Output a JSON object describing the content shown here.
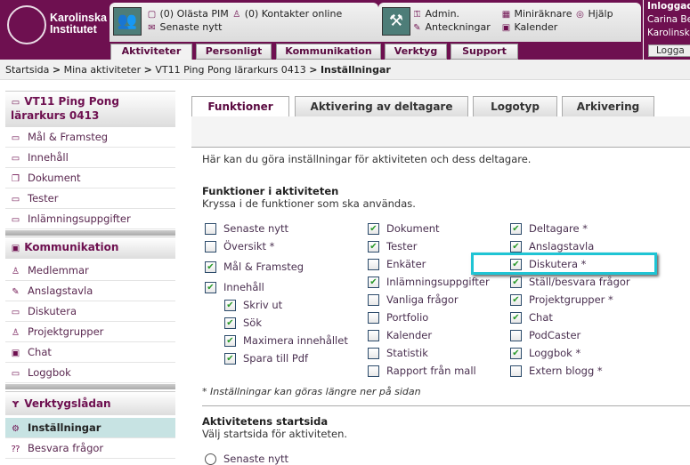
{
  "brand": {
    "name_line1": "Karolinska",
    "name_line2": "Institutet",
    "seal_text": "KAROLINSKA INSTITUTET ANNO 1810",
    "color": "#6e1050"
  },
  "header": {
    "pim": "(0) Olästa PIM",
    "contacts": "(0) Kontakter online",
    "news": "Senaste nytt",
    "admin": "Admin.",
    "notes": "Anteckningar",
    "calc": "Miniräknare",
    "calendar": "Kalender",
    "help": "Hjälp",
    "nav": [
      "Aktiviteter",
      "Personligt",
      "Kommunikation",
      "Verktyg",
      "Support"
    ],
    "user_label": "Inloggad",
    "user_name": "Carina Be",
    "user_org": "Karolinsk",
    "logout": "Logga"
  },
  "breadcrumb": [
    "Startsida",
    "Mina aktiviteter",
    "VT11 Ping Pong lärarkurs 0413",
    "Inställningar"
  ],
  "sidebar": {
    "course_line1": "VT11 Ping Pong",
    "course_line2": "lärarkurs 0413",
    "course_items": [
      "Mål & Framsteg",
      "Innehåll",
      "Dokument",
      "Tester",
      "Inlämningsuppgifter"
    ],
    "comm_title": "Kommunikation",
    "comm_items": [
      "Medlemmar",
      "Anslagstavla",
      "Diskutera",
      "Projektgrupper",
      "Chat",
      "Loggbok"
    ],
    "tools_title": "Verktygslådan",
    "tools_items": [
      "Inställningar",
      "Besvara frågor"
    ]
  },
  "tabs": [
    "Funktioner",
    "Aktivering av deltagare",
    "Logotyp",
    "Arkivering"
  ],
  "main": {
    "intro": "Här kan du göra inställningar för aktiviteten och dess deltagare.",
    "func_title": "Funktioner i aktiviteten",
    "func_sub": "Kryssa i de funktioner som ska användas.",
    "col1": [
      {
        "label": "Senaste nytt",
        "checked": false
      },
      {
        "label": "Översikt *",
        "checked": false
      },
      {
        "label": "Mål & Framsteg",
        "checked": true
      },
      {
        "label": "Innehåll",
        "checked": true
      }
    ],
    "col1_sub": [
      {
        "label": "Skriv ut",
        "checked": true
      },
      {
        "label": "Sök",
        "checked": true
      },
      {
        "label": "Maximera innehållet",
        "checked": true
      },
      {
        "label": "Spara till Pdf",
        "checked": true
      }
    ],
    "col2": [
      {
        "label": "Dokument",
        "checked": true
      },
      {
        "label": "Tester",
        "checked": true
      },
      {
        "label": "Enkäter",
        "checked": false
      },
      {
        "label": "Inlämningsuppgifter",
        "checked": true
      },
      {
        "label": "Vanliga frågor",
        "checked": false
      },
      {
        "label": "Portfolio",
        "checked": false
      },
      {
        "label": "Kalender",
        "checked": false
      },
      {
        "label": "Statistik",
        "checked": false
      },
      {
        "label": "Rapport från mall",
        "checked": false
      }
    ],
    "col3": [
      {
        "label": "Deltagare *",
        "checked": true
      },
      {
        "label": "Anslagstavla",
        "checked": true
      },
      {
        "label": "Diskutera *",
        "checked": true
      },
      {
        "label": "Ställ/besvara frågor",
        "checked": true
      },
      {
        "label": "Projektgrupper *",
        "checked": true
      },
      {
        "label": "Chat",
        "checked": true
      },
      {
        "label": "PodCaster",
        "checked": false
      },
      {
        "label": "Loggbok *",
        "checked": true
      },
      {
        "label": "Extern blogg *",
        "checked": false
      }
    ],
    "note": "* Inställningar kan göras längre ner på sidan",
    "start_title": "Aktivitetens startsida",
    "start_sub": "Välj startsida för aktiviteten.",
    "start_option": "Senaste nytt",
    "highlight_color": "#1fc4d4"
  }
}
